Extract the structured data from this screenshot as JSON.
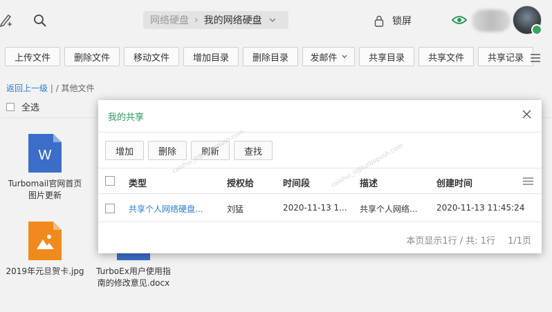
{
  "breadcrumb": {
    "parent": "网络硬盘",
    "current": "我的网络硬盘"
  },
  "lockscreen": {
    "label": "锁屏"
  },
  "toolbar": [
    "上传文件",
    "删除文件",
    "移动文件",
    "增加目录",
    "删除目录",
    "发邮件",
    "共享目录",
    "共享文件",
    "共享记录"
  ],
  "path": {
    "back": "返回上一级 |",
    "rest": "/ 其他文件"
  },
  "select_all": "全选",
  "files": [
    {
      "name": "Turbomail官网首页图片更新",
      "type": "word",
      "icon_letter": "W"
    },
    {
      "name": "2019年元旦贺卡.jpg",
      "type": "image"
    },
    {
      "name": "TurboEx用户使用指南的修改意见.docx",
      "type": "word"
    }
  ],
  "modal": {
    "title": "我的共享",
    "buttons": [
      "增加",
      "删除",
      "刷新",
      "查找"
    ],
    "columns": [
      "类型",
      "授权给",
      "时间段",
      "描述",
      "创建时间"
    ],
    "rows": [
      {
        "type": "共享个人网络硬盘...",
        "grantee": "刘猛",
        "period": "2020-11-13 1...",
        "desc": "共享个人网络...",
        "created": "2020-11-13 11:45:24"
      }
    ],
    "pager": {
      "summary": "本页显示1行 / 共: 1行",
      "page": "1/1页"
    }
  },
  "watermark": "caishui_li@turbopush.com",
  "colors": {
    "accent_green": "#2a9a5a",
    "link_blue": "#2a7bd1",
    "word_blue": "#3b6ec9",
    "image_orange": "#f08a1c"
  }
}
